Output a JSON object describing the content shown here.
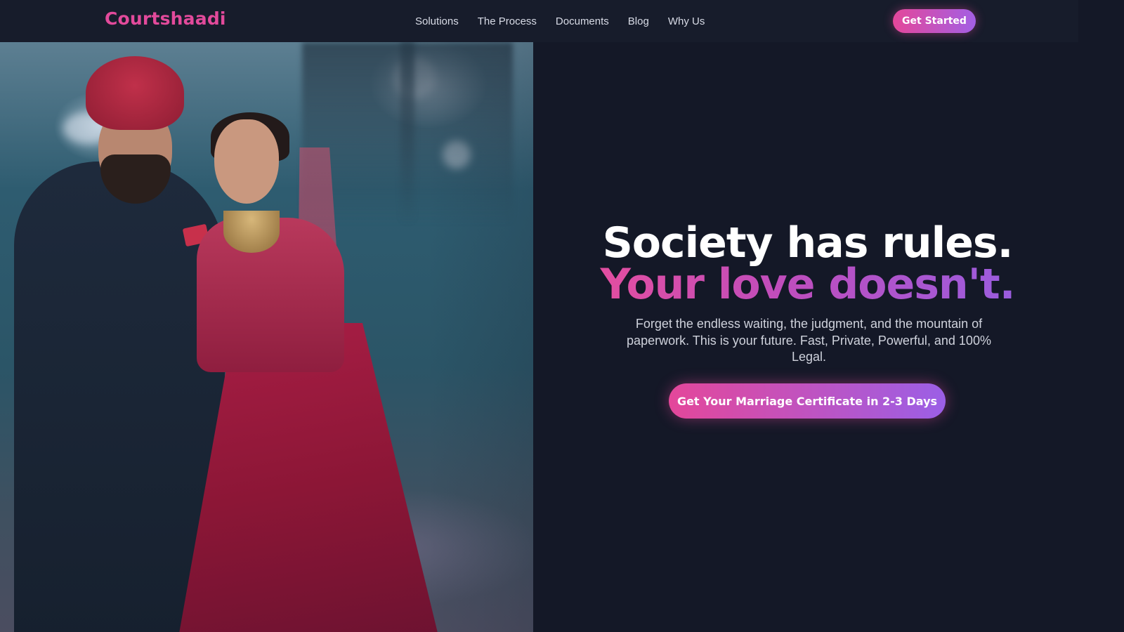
{
  "brand": {
    "name": "Courtshaadi",
    "accent_color": "#e24a9b",
    "gradient_start": "#e4479a",
    "gradient_end": "#9b5fe6",
    "background": "#141827"
  },
  "nav": {
    "links": [
      "Solutions",
      "The Process",
      "Documents",
      "Blog",
      "Why Us"
    ],
    "cta_label": "Get Started"
  },
  "hero": {
    "headline_line1": "Society has rules.",
    "headline_line2": "Your love doesn't.",
    "subtext": "Forget the endless waiting, the judgment, and the mountain of paperwork. This is your future. Fast, Private, Powerful, and 100% Legal.",
    "cta_label": "Get Your Marriage Certificate in 2-3 Days",
    "image_alt": "Couple in traditional wedding attire"
  }
}
